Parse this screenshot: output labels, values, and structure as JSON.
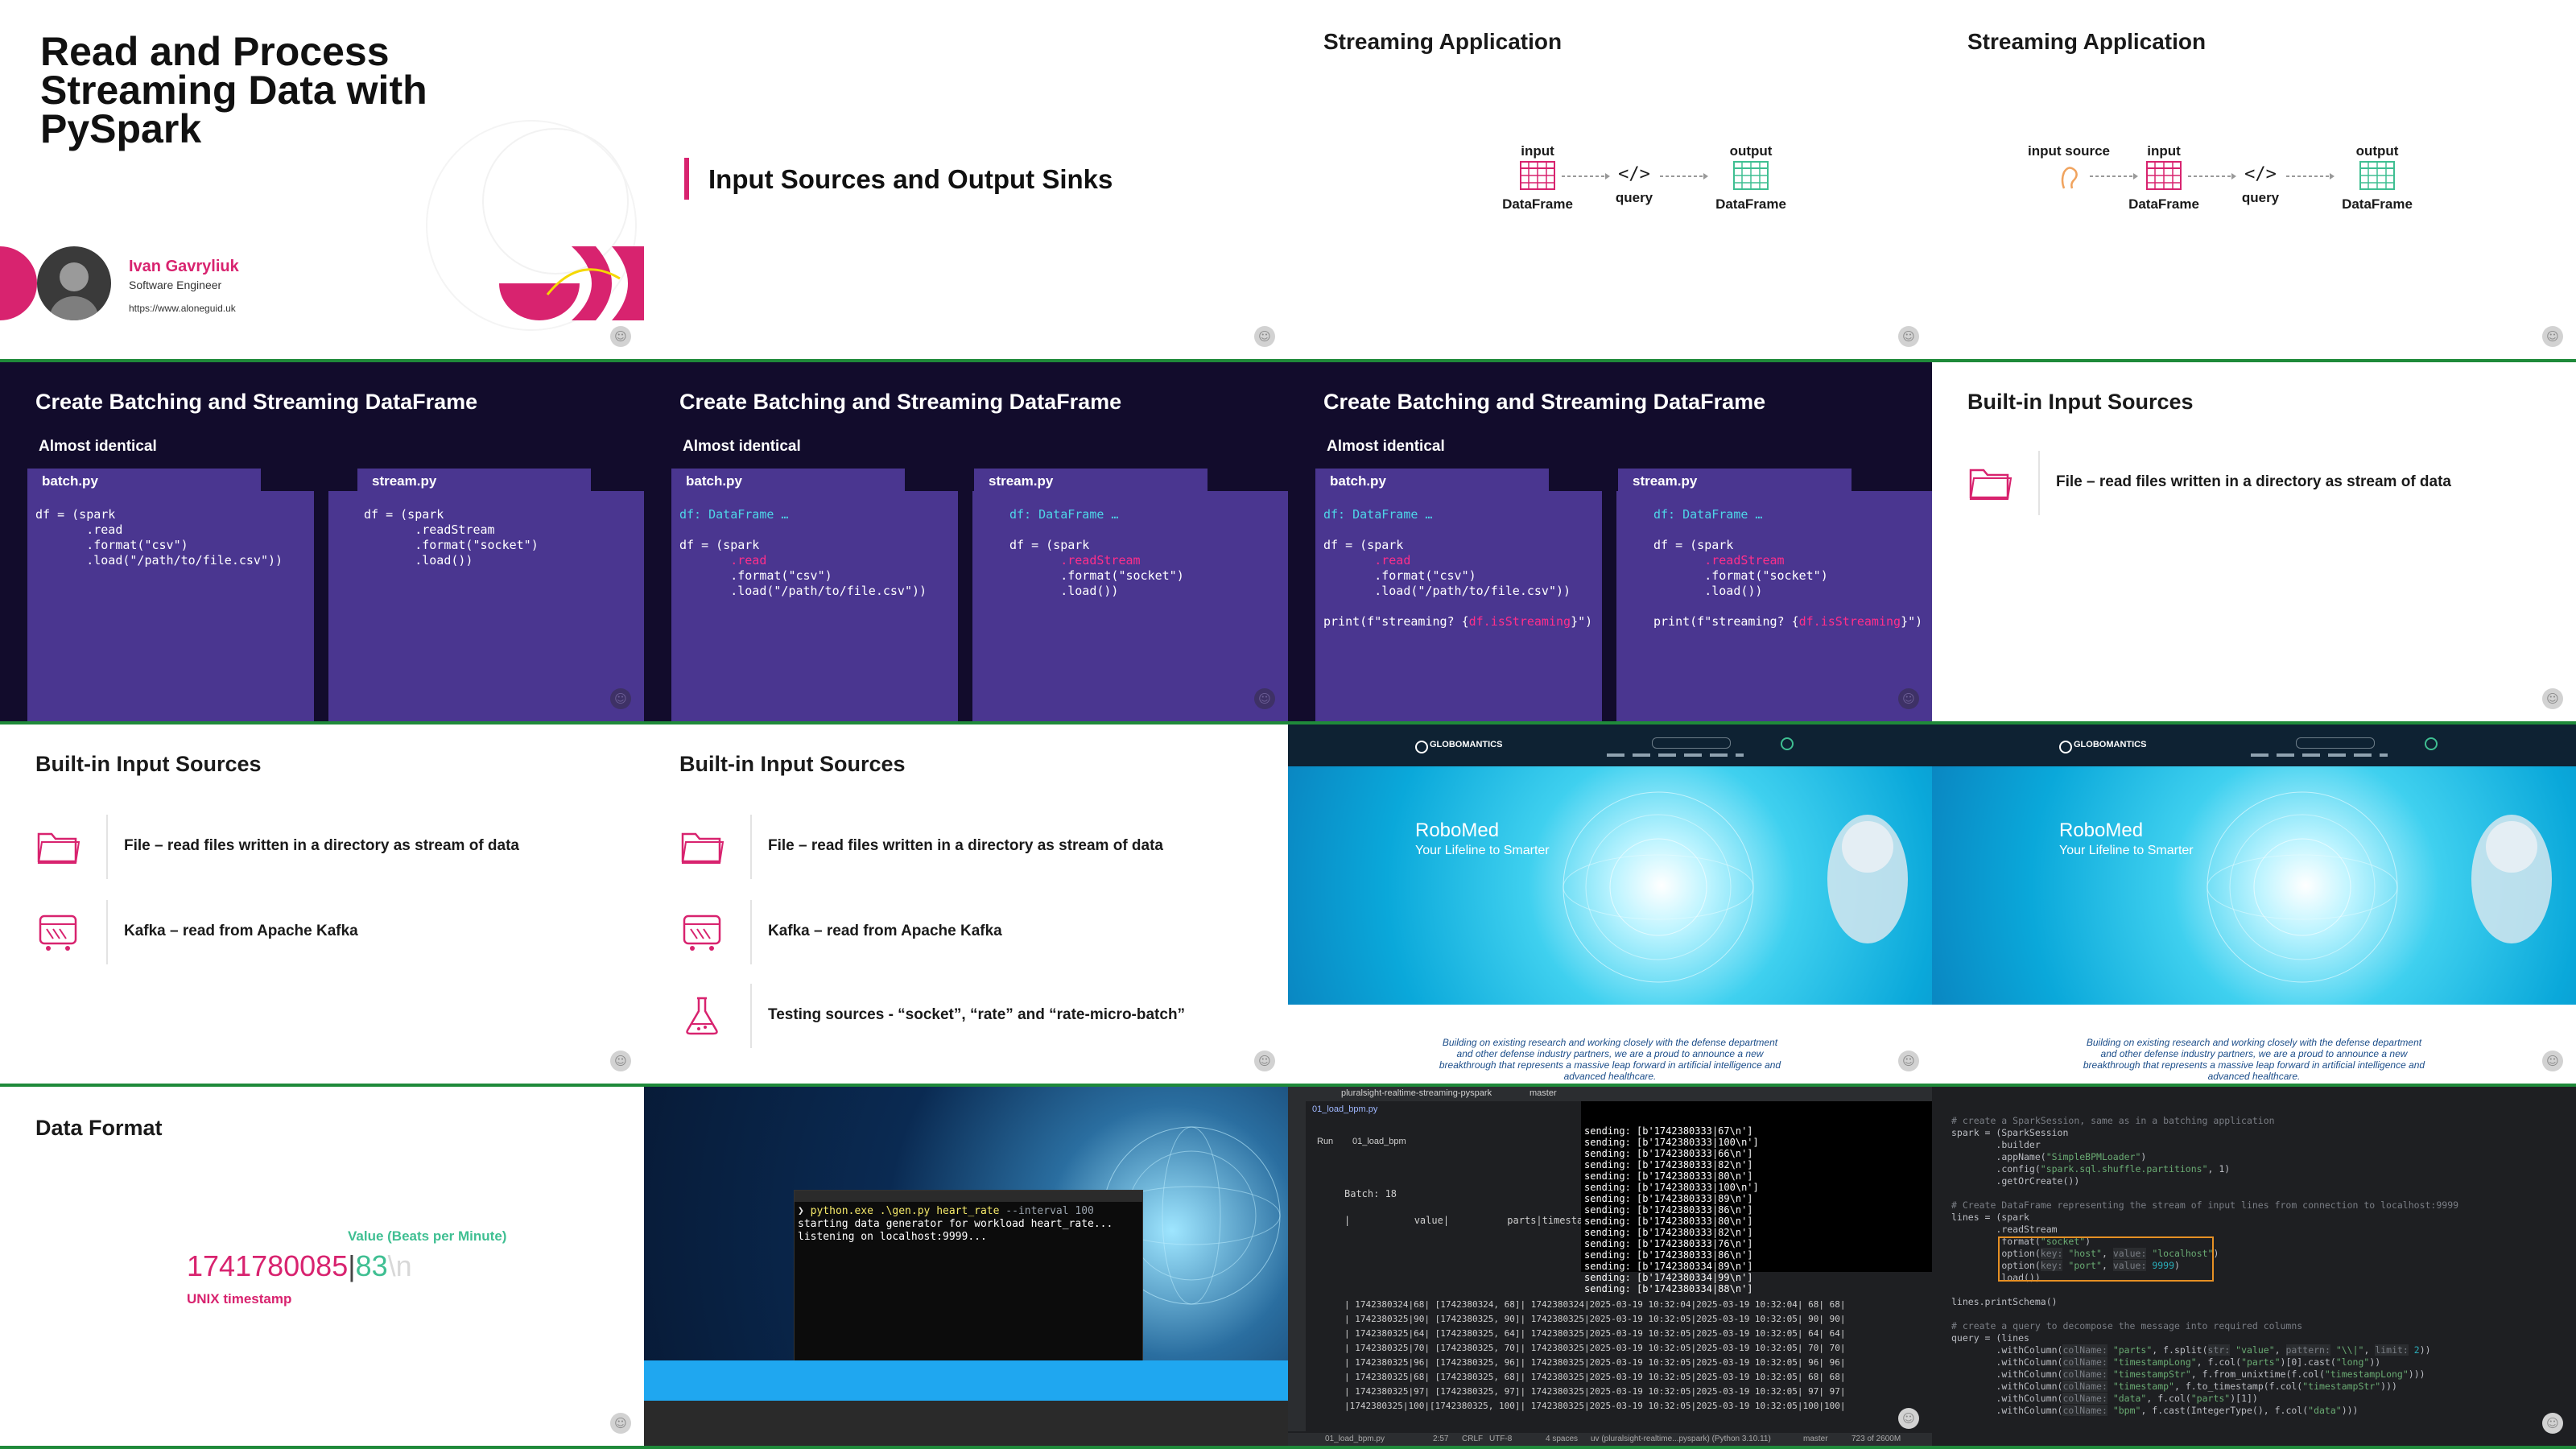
{
  "tiles": {
    "intro": {
      "title_lines": [
        "Read and Process",
        "Streaming Data with",
        "PySpark"
      ],
      "author_name": "Ivan Gavryliuk",
      "author_role": "Software Engineer",
      "author_url": "https://www.aloneguid.uk"
    },
    "section": {
      "heading": "Input Sources and Output Sinks"
    },
    "stream_app_1": {
      "title": "Streaming Application",
      "input_label": "input",
      "input_caption": "DataFrame",
      "query_glyph": "</>",
      "query_label": "query",
      "output_label": "output",
      "output_caption": "DataFrame"
    },
    "stream_app_2": {
      "title": "Streaming Application",
      "source_label": "input source",
      "input_label": "input",
      "input_caption": "DataFrame",
      "query_glyph": "</>",
      "query_label": "query",
      "output_label": "output",
      "output_caption": "DataFrame"
    },
    "batch_stream_1": {
      "title": "Create Batching and Streaming DataFrame",
      "subtitle": "Almost identical",
      "left_tab": "batch.py",
      "right_tab": "stream.py",
      "left_code": "df = (spark\n       .read\n       .format(\"csv\")\n       .load(\"/path/to/file.csv\"))",
      "right_code": "df = (spark\n       .readStream\n       .format(\"socket\")\n       .load())"
    },
    "batch_stream_2": {
      "title": "Create Batching and Streaming DataFrame",
      "subtitle": "Almost identical",
      "left_tab": "batch.py",
      "right_tab": "stream.py",
      "left_hint": "df: DataFrame …",
      "left_l1": "df = (spark",
      "left_l2": ".read",
      "left_l3": ".format(\"csv\")",
      "left_l4": ".load(\"/path/to/file.csv\"))",
      "right_hint": "df: DataFrame …",
      "right_l1": "df = (spark",
      "right_l2": ".readStream",
      "right_l3": ".format(\"socket\")",
      "right_l4": ".load())"
    },
    "batch_stream_3": {
      "title": "Create Batching and Streaming DataFrame",
      "subtitle": "Almost identical",
      "left_tab": "batch.py",
      "right_tab": "stream.py",
      "left_hint": "df: DataFrame …",
      "left_l1": "df = (spark",
      "left_l2": ".read",
      "left_l3": ".format(\"csv\")",
      "left_l4": ".load(\"/path/to/file.csv\"))",
      "left_print_a": "print(f\"streaming? {",
      "left_print_b": "df.isStreaming",
      "left_print_c": "}\")",
      "right_hint": "df: DataFrame …",
      "right_l1": "df = (spark",
      "right_l2": ".readStream",
      "right_l3": ".format(\"socket\")",
      "right_l4": ".load())",
      "right_print_a": "print(f\"streaming? {",
      "right_print_b": "df.isStreaming",
      "right_print_c": "}\")"
    },
    "sources_1": {
      "title": "Built-in Input Sources",
      "file_label": "File – read files written in a directory as stream of data"
    },
    "sources_2": {
      "title": "Built-in Input Sources",
      "file_label": "File – read files written in a directory as stream of data",
      "kafka_label": "Kafka – read from Apache Kafka"
    },
    "sources_3": {
      "title": "Built-in Input Sources",
      "file_label": "File – read files written in a directory as stream of data",
      "kafka_label": "Kafka – read from Apache Kafka",
      "testing_label": "Testing sources - “socket”, “rate” and “rate-micro-batch”"
    },
    "website": {
      "brand": "GLOBOMANTICS",
      "hero_title": "RoboMed",
      "hero_tagline": "Your Lifeline to Smarter",
      "body_line1": "Building on existing research and working closely with the defense department",
      "body_line2": "and other defense industry partners, we are a proud to announce a new",
      "body_line3": "breakthrough that represents a massive leap forward in artificial intelligence and",
      "body_line4": "advanced healthcare."
    },
    "data_format": {
      "title": "Data Format",
      "value_label": "Value (Beats per Minute)",
      "timestamp": "1741780085",
      "separator": "|",
      "value": "83",
      "newline": "\\n",
      "timestamp_label": "UNIX timestamp"
    },
    "terminal": {
      "prompt": "❯",
      "command": "python.exe .\\gen.py heart_rate",
      "flag": "--interval 100",
      "out1": "starting data generator for workload heart_rate...",
      "out2": "listening on localhost:9999..."
    },
    "ide": {
      "project": "pluralsight-realtime-streaming-pyspark",
      "branch": "master",
      "tab1": "01_load_bpm.py",
      "tab2": "01_load_bpm",
      "run_label": "Run",
      "batch_label": "Batch: 18",
      "col_headers": "|           value|          parts|timestamp|",
      "sending_lines": [
        "sending: [b'1742380333|67\\n']",
        "sending: [b'1742380333|100\\n']",
        "sending: [b'1742380333|66\\n']",
        "sending: [b'1742380333|82\\n']",
        "sending: [b'1742380333|80\\n']",
        "sending: [b'1742380333|100\\n']",
        "sending: [b'1742380333|89\\n']",
        "sending: [b'1742380333|86\\n']",
        "sending: [b'1742380333|80\\n']",
        "sending: [b'1742380333|82\\n']",
        "sending: [b'1742380333|76\\n']",
        "sending: [b'1742380333|86\\n']",
        "sending: [b'1742380334|89\\n']",
        "sending: [b'1742380334|99\\n']",
        "sending: [b'1742380334|88\\n']"
      ],
      "rows": [
        "| 1742380324|68| [1742380324, 68]| 1742380324|2025-03-19 10:32:04|2025-03-19 10:32:04| 68| 68|",
        "| 1742380325|90| [1742380325, 90]| 1742380325|2025-03-19 10:32:05|2025-03-19 10:32:05| 90| 90|",
        "| 1742380325|64| [1742380325, 64]| 1742380325|2025-03-19 10:32:05|2025-03-19 10:32:05| 64| 64|",
        "| 1742380325|70| [1742380325, 70]| 1742380325|2025-03-19 10:32:05|2025-03-19 10:32:05| 70| 70|",
        "| 1742380325|96| [1742380325, 96]| 1742380325|2025-03-19 10:32:05|2025-03-19 10:32:05| 96| 96|",
        "| 1742380325|68| [1742380325, 68]| 1742380325|2025-03-19 10:32:05|2025-03-19 10:32:05| 68| 68|",
        "| 1742380325|97| [1742380325, 97]| 1742380325|2025-03-19 10:32:05|2025-03-19 10:32:05| 97| 97|",
        "|1742380325|100|[1742380325, 100]| 1742380325|2025-03-19 10:32:05|2025-03-19 10:32:05|100|100|"
      ],
      "status_file": "01_load_bpm.py",
      "status_pos": "2:57",
      "status_crlf": "CRLF",
      "status_enc": "UTF-8",
      "status_indent": "4 spaces",
      "status_env": "uv (pluralsight-realtime...pyspark) (Python 3.10.11)",
      "status_branch": "master",
      "status_mem": "723 of 2600M"
    },
    "code_editor": {
      "c1": "# create a SparkSession, same as in a batching application",
      "l1": "spark = (SparkSession",
      "l2": ".builder",
      "l3_a": ".appName(",
      "l3_s": "\"SimpleBPMLoader\"",
      "l3_c": ")",
      "l4_a": ".config(",
      "l4_s": "\"spark.sql.shuffle.partitions\"",
      "l4_c": ", 1)",
      "l5": ".getOrCreate())",
      "c2": "# Create DataFrame representing the stream of input lines from connection to localhost:9999",
      "l6": "lines = (spark",
      "l7": ".readStream",
      "l8_a": ".format(",
      "l8_s": "\"socket\"",
      "l8_c": ")",
      "l9_a": ".option(",
      "l9_k": "key:",
      "l9_s1": "\"host\"",
      "l9_v": "value:",
      "l9_s2": "\"localhost\"",
      "l9_c": ")",
      "l10_a": ".option(",
      "l10_k": "key:",
      "l10_s1": "\"port\"",
      "l10_v": "value:",
      "l10_n": "9999",
      "l10_c": ")",
      "l11": ".load())",
      "l12": "lines.printSchema()",
      "c3": "# create a query to decompose the message into required columns",
      "l13": "query = (lines",
      "l14_a": ".withColumn(",
      "l14_h": "colName:",
      "l14_s": "\"parts\"",
      "l14_b": ", f.split(",
      "l14_h2": "str:",
      "l14_s2": "\"value\"",
      "l14_c": ", ",
      "l14_h3": "pattern:",
      "l14_s3": "\"\\\\|\"",
      "l14_d": ", ",
      "l14_h4": "limit:",
      "l14_n": "2",
      "l14_e": "))",
      "l15_a": ".withColumn(",
      "l15_h": "colName:",
      "l15_s": "\"timestampLong\"",
      "l15_b": ", f.col(",
      "l15_s2": "\"parts\"",
      "l15_c": ")[0].cast(",
      "l15_s3": "\"long\"",
      "l15_d": "))",
      "l16_a": ".withColumn(",
      "l16_h": "colName:",
      "l16_s": "\"timestampStr\"",
      "l16_b": ", f.from_unixtime(f.col(",
      "l16_s2": "\"timestampLong\"",
      "l16_c": ")))",
      "l17_a": ".withColumn(",
      "l17_h": "colName:",
      "l17_s": "\"timestamp\"",
      "l17_b": ", f.to_timestamp(f.col(",
      "l17_s2": "\"timestampStr\"",
      "l17_c": ")))",
      "l18_a": ".withColumn(",
      "l18_h": "colName:",
      "l18_s": "\"data\"",
      "l18_b": ", f.col(",
      "l18_s2": "\"parts\"",
      "l18_c": ")[1])",
      "l19_a": ".withColumn(",
      "l19_h": "colName:",
      "l19_s": "\"bpm\"",
      "l19_b": ", f.cast(IntegerType(), f.col(",
      "l19_s2": "\"data\"",
      "l19_c": ")))"
    }
  },
  "colors": {
    "accent_pink": "#d8236f",
    "slide_dark": "#120c2c",
    "code_panel": "#4a3690",
    "code_cyan": "#4ed6e8",
    "code_pink": "#ff2f8a",
    "table_green": "#3fbf92",
    "highlight_orange": "#e69024",
    "separator_green": "#1f8a3a"
  }
}
